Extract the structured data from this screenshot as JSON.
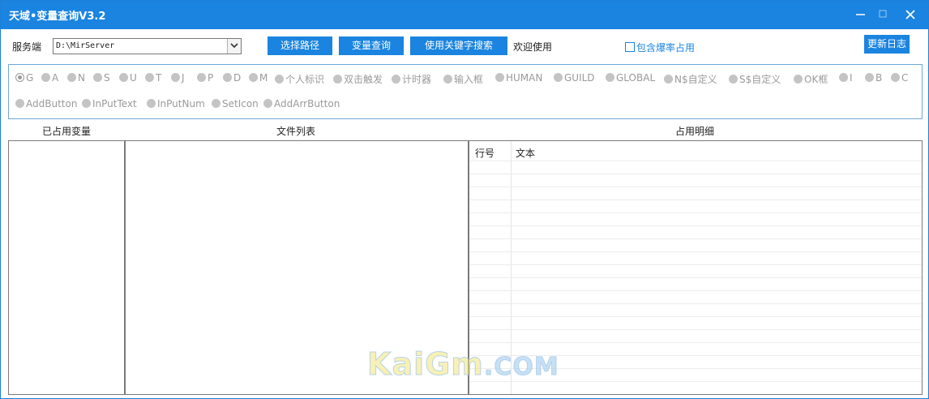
{
  "window": {
    "title": "天域•变量查询V3.2"
  },
  "toolbar": {
    "server_label": "服务端",
    "server_path": "D:\\MirServer",
    "choose_path_label": "选择路径",
    "query_label": "变量查询",
    "keyword_search_label": "使用关键字搜索",
    "welcome_text": "欢迎使用",
    "include_burst_label": "包含爆率占用",
    "changelog_label": "更新日志"
  },
  "variable_types": {
    "selected": "G",
    "row1": [
      "G",
      "A",
      "N",
      "S",
      "U",
      "T",
      "J",
      "P",
      "D",
      "M",
      "个人标识",
      "双击触发",
      "计时器",
      "输入框",
      "HUMAN",
      "GUILD",
      "GLOBAL",
      "N$自定义",
      "S$自定义",
      "OK框",
      "I",
      "B",
      "C"
    ],
    "row2": [
      "AddButton",
      "InPutText",
      "InPutNum",
      "SetIcon",
      "AddArrButton"
    ]
  },
  "sections": {
    "used_variables": "已占用变量",
    "file_list": "文件列表",
    "usage_detail": "占用明细"
  },
  "detail_grid": {
    "col_line": "行号",
    "col_text": "文本"
  },
  "watermark": {
    "main": "KaiGm",
    "suffix": ".COM"
  },
  "colors": {
    "accent": "#1a84e0",
    "radio_gray": "#c4c4c4"
  }
}
